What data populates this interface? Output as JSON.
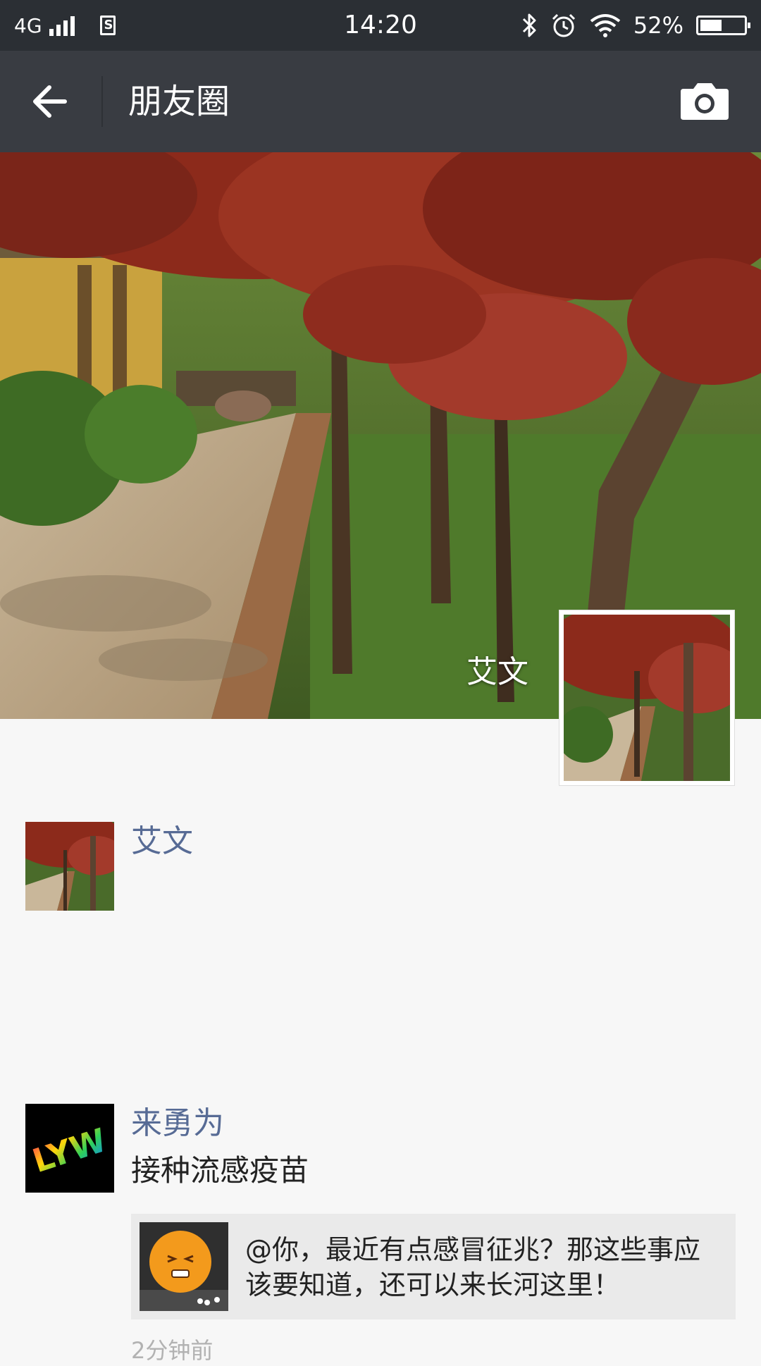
{
  "status_bar": {
    "network": "4G",
    "time": "14:20",
    "battery_percent_label": "52%",
    "battery_level": 0.52,
    "icons": [
      "signal-icon",
      "sim-icon",
      "bluetooth-icon",
      "alarm-icon",
      "wifi-icon",
      "battery-icon"
    ]
  },
  "nav": {
    "title": "朋友圈",
    "back_icon": "back-arrow-icon",
    "camera_icon": "camera-icon"
  },
  "cover": {
    "owner_name": "艾文"
  },
  "posts": [
    {
      "author": "艾文",
      "text": "",
      "avatar": "maple-path-photo"
    },
    {
      "author": "来勇为",
      "text": "接种流感疫苗",
      "avatar": "lyw-logo",
      "share": {
        "text": "@你，最近有点感冒征兆？那这些事应该要知道，还可以来长河这里！",
        "thumb": "orange-face-photo"
      },
      "time": "2分钟前"
    }
  ],
  "colors": {
    "status_bar_bg": "#2b2f34",
    "nav_bg": "#393c42",
    "page_bg": "#f7f7f7",
    "author_name": "#576b95",
    "share_card_bg": "#eaeaea"
  }
}
